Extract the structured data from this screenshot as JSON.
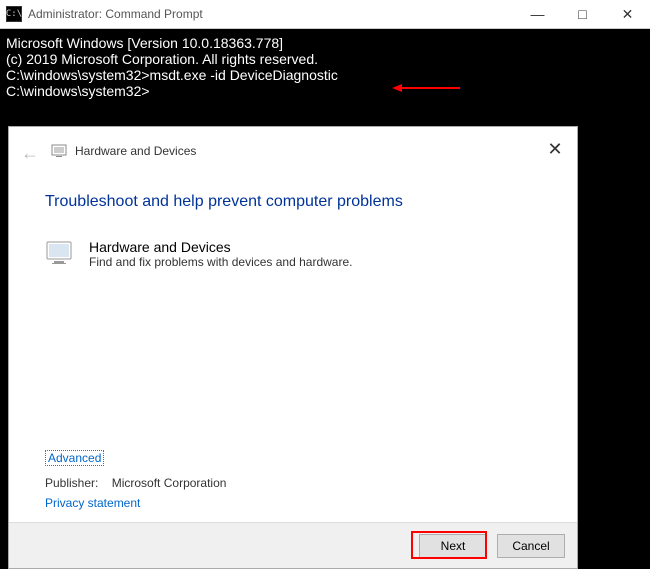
{
  "cmd": {
    "title": "Administrator: Command Prompt",
    "lines": {
      "l1": "Microsoft Windows [Version 10.0.18363.778]",
      "l2": "(c) 2019 Microsoft Corporation. All rights reserved.",
      "l3": "",
      "l4": "C:\\windows\\system32>msdt.exe -id DeviceDiagnostic",
      "l5": "",
      "l6": "C:\\windows\\system32>"
    },
    "controls": {
      "min": "—",
      "max": "□",
      "close": "✕"
    }
  },
  "dialog": {
    "title": "Hardware and Devices",
    "close": "✕",
    "heading": "Troubleshoot and help prevent computer problems",
    "item": {
      "name": "Hardware and Devices",
      "desc": "Find and fix problems with devices and hardware."
    },
    "advanced": "Advanced",
    "publisher_label": "Publisher:",
    "publisher_value": "Microsoft Corporation",
    "privacy": "Privacy statement",
    "buttons": {
      "next": "Next",
      "cancel": "Cancel"
    }
  }
}
